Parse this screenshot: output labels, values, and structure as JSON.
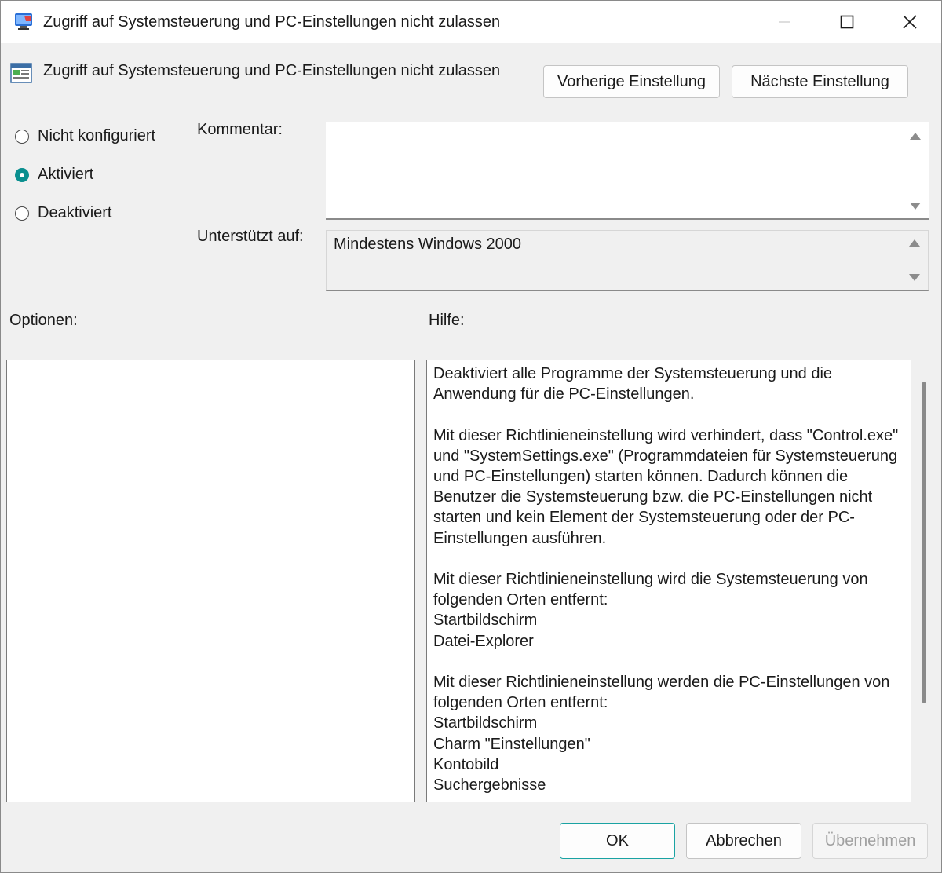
{
  "window": {
    "title": "Zugriff auf Systemsteuerung und PC-Einstellungen nicht zulassen"
  },
  "policy": {
    "name": "Zugriff auf Systemsteuerung und PC-Einstellungen nicht zulassen",
    "prev_button": "Vorherige Einstellung",
    "next_button": "Nächste Einstellung"
  },
  "state": {
    "options": [
      {
        "label": "Nicht konfiguriert",
        "checked": false
      },
      {
        "label": "Aktiviert",
        "checked": true
      },
      {
        "label": "Deaktiviert",
        "checked": false
      }
    ]
  },
  "fields": {
    "comment_label": "Kommentar:",
    "comment_value": "",
    "supported_label": "Unterstützt auf:",
    "supported_value": "Mindestens Windows 2000"
  },
  "panes": {
    "options_label": "Optionen:",
    "help_label": "Hilfe:",
    "help_text": "Deaktiviert alle Programme der Systemsteuerung und die Anwendung für die PC-Einstellungen.\n\nMit dieser Richtlinieneinstellung wird verhindert, dass \"Control.exe\" und \"SystemSettings.exe\" (Programmdateien für Systemsteuerung und PC-Einstellungen) starten können. Dadurch können die Benutzer die Systemsteuerung bzw. die PC-Einstellungen nicht starten und kein Element der Systemsteuerung oder der PC-Einstellungen ausführen.\n\nMit dieser Richtlinieneinstellung wird die Systemsteuerung von folgenden Orten entfernt:\nStartbildschirm\nDatei-Explorer\n\nMit dieser Richtlinieneinstellung werden die PC-Einstellungen von folgenden Orten entfernt:\nStartbildschirm\nCharm \"Einstellungen\"\nKontobild\nSuchergebnisse"
  },
  "footer": {
    "ok": "OK",
    "cancel": "Abbrechen",
    "apply": "Übernehmen"
  },
  "colors": {
    "accent": "#0a8f8f",
    "window_bg": "#f0f0f0"
  }
}
